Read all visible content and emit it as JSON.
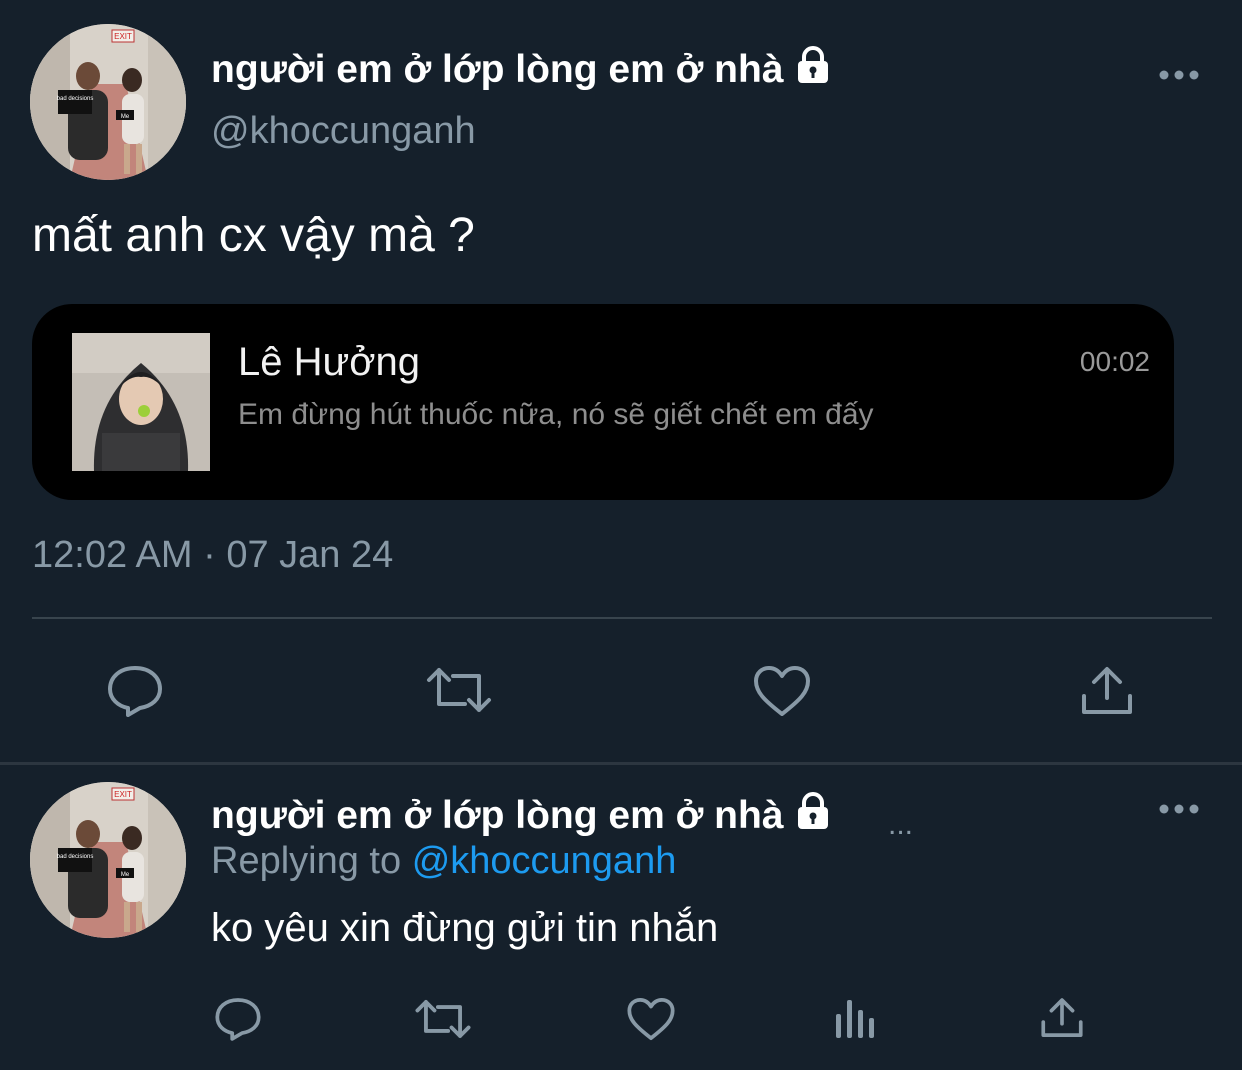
{
  "tweet": {
    "display_name": "người em ở lớp lòng em ở nhà",
    "handle": "@khoccunganh",
    "text": "mất anh cx vậy mà ?",
    "timestamp": "12:02 AM · 07 Jan 24",
    "avatar_stickers": {
      "left": "bad decisions",
      "right": "Me"
    },
    "avatar_sign": "EXIT"
  },
  "embed": {
    "name": "Lê Hưởng",
    "time": "00:02",
    "message": "Em đừng hút thuốc nữa, nó sẽ giết chết em đấy"
  },
  "actions": {
    "icons": [
      "reply-icon",
      "retweet-icon",
      "like-icon",
      "share-icon"
    ]
  },
  "reply": {
    "display_name": "người em ở lớp lòng em ở nhà",
    "ellipsis": "...",
    "replying_prefix": "Replying to",
    "replying_handle": "@khoccunganh",
    "text": "ko yêu xin đừng gửi tin nhắn",
    "icons": [
      "reply-icon",
      "retweet-icon",
      "like-icon",
      "analytics-icon",
      "share-icon"
    ]
  },
  "colors": {
    "background": "#15202b",
    "secondary_text": "#8899a6",
    "mention": "#1d9bf0",
    "divider": "#38444d",
    "embed_background": "#000000"
  }
}
